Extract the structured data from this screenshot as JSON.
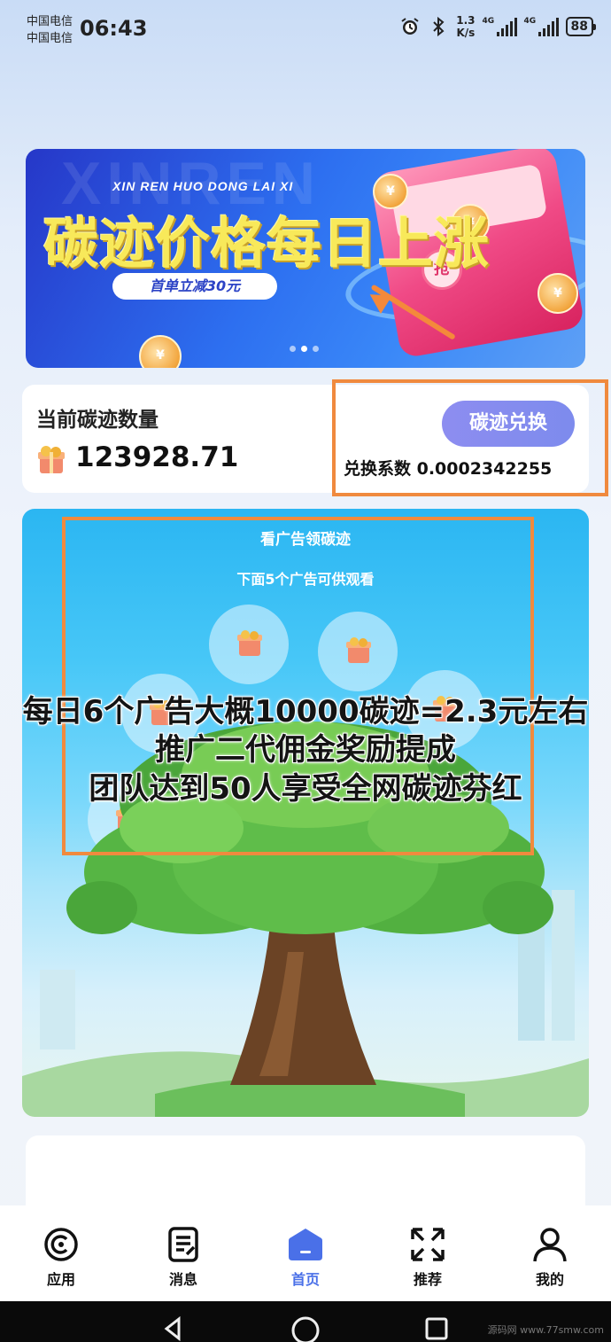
{
  "status_bar": {
    "carrier_1": "中国电信",
    "carrier_2": "中国电信",
    "time": "06:43",
    "speed_value": "1.3",
    "speed_unit": "K/s",
    "signal_1": "4G",
    "signal_2": "4G",
    "battery": "88"
  },
  "banner": {
    "watermark": "XINREN",
    "subtitle": "XIN REN HUO DONG LAI XI",
    "headline": "碳迹价格每日上涨",
    "pill": "首单立减30元",
    "grab": "抢"
  },
  "carbon": {
    "label": "当前碳迹数量",
    "value": "123928.71",
    "exchange_button": "碳迹兑换",
    "exchange_rate": "兑换系数 0.0002342255"
  },
  "ad_panel": {
    "title": "看广告领碳迹",
    "subtitle": "下面5个广告可供观看"
  },
  "overlay": {
    "line1": "每日6个广告大概10000碳迹=2.3元左右",
    "line2": "推广二代佣金奖励提成",
    "line3": "团队达到50人享受全网碳迹芬红"
  },
  "tabs": [
    {
      "label": "应用",
      "icon": "apps-icon"
    },
    {
      "label": "消息",
      "icon": "message-icon"
    },
    {
      "label": "首页",
      "icon": "home-icon"
    },
    {
      "label": "推荐",
      "icon": "recommend-icon"
    },
    {
      "label": "我的",
      "icon": "profile-icon"
    }
  ],
  "nav_watermark": "源码网 www.77smw.com",
  "colors": {
    "accent": "#4a70e8",
    "highlight": "#f08a3e",
    "exchange_button": "#8d8df0"
  }
}
